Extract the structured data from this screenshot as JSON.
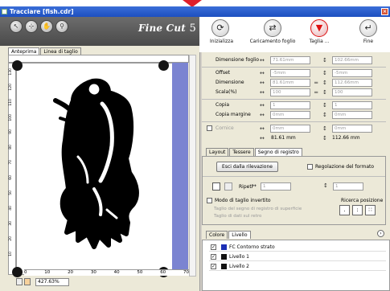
{
  "window": {
    "title": "Tracciare [fish.cdr]"
  },
  "colors": {
    "title_bar": "#1d4fc0",
    "accent_red": "#e0202b",
    "band_blue": "#7b84d1"
  },
  "toolbar": {
    "tools_left": [
      "arrow-tool-icon",
      "node-tool-icon",
      "hand-tool-icon",
      "zoom-tool-icon"
    ],
    "logo_text": "Fine Cut",
    "logo_version": "5",
    "buttons": [
      {
        "label": "Inizializza",
        "icon": "refresh-icon"
      },
      {
        "label": "Caricamento foglio",
        "icon": "swap-arrows-icon"
      },
      {
        "label": "Taglia ...",
        "icon": "cut-pen-icon"
      },
      {
        "label": "Fine",
        "icon": "return-icon"
      }
    ]
  },
  "left_tabs": [
    "Anteprima",
    "Linea di taglio"
  ],
  "status": {
    "zoom": "427.63%"
  },
  "ruler_bottom": [
    "0",
    "10",
    "20",
    "30",
    "40",
    "50",
    "60",
    "70"
  ],
  "ruler_left": [
    "130",
    "120",
    "110",
    "100",
    "90",
    "80",
    "70",
    "60",
    "50",
    "40",
    "30",
    "20",
    "10"
  ],
  "properties": {
    "sheet_size": {
      "label": "Dimensione foglio",
      "w": "71.61mm",
      "h": "102.66mm"
    },
    "offset": {
      "label": "Offset",
      "w": "-5mm",
      "h": "-5mm"
    },
    "dimension": {
      "label": "Dimensione",
      "w": "81.61mm",
      "h": "112.66mm"
    },
    "scale": {
      "label": "Scala(%)",
      "w": "100",
      "h": "100"
    },
    "copies": {
      "label": "Copia",
      "w": "1",
      "h": "1"
    },
    "copy_margin": {
      "label": "Copia margine",
      "w": "0mm",
      "h": "0mm"
    },
    "frame": {
      "label": "Cornice",
      "w": "0mm",
      "h": "0mm"
    },
    "totals": {
      "w": "81.61 mm",
      "h": "112.66 mm"
    }
  },
  "mid_tabs": [
    "Layout",
    "Tessere",
    "Segno di registro"
  ],
  "registration": {
    "exit_button": "Esci dalla rilevazione",
    "format_adjust": "Regolazione del formato",
    "repeat_label": "Ripeti",
    "repeat_x": "1",
    "repeat_y": "1",
    "invert_mode": "Modo di taglio invertito",
    "option1": "Taglio del segno di registro di superficie",
    "option2": "Taglio di dati sul retro",
    "search_position": "Ricerca posizione"
  },
  "bottom_tabs": [
    "Colore",
    "Livello"
  ],
  "layers": [
    {
      "name": "FC Contorno strato",
      "color": "#1c2fb5"
    },
    {
      "name": "Livello 1",
      "color": "#111111"
    },
    {
      "name": "Livello 2",
      "color": "#111111"
    }
  ]
}
